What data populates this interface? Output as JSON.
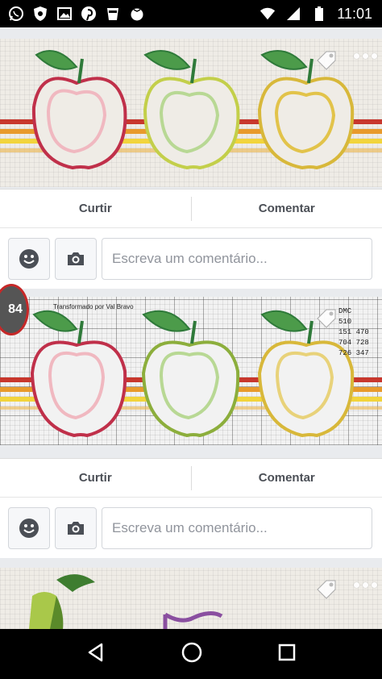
{
  "status_bar": {
    "time": "11:01",
    "left_icons": [
      "whatsapp-icon",
      "shield-icon",
      "image-icon",
      "pinterest-icon",
      "cup-icon",
      "tomato-icon"
    ],
    "right_icons": [
      "wifi-icon",
      "signal-icon",
      "battery-icon"
    ]
  },
  "posts": [
    {
      "image": "apple-cross-stitch",
      "like_label": "Curtir",
      "comment_label": "Comentar",
      "comment_placeholder": "Escreva um comentário..."
    },
    {
      "image": "apple-cross-stitch-chart",
      "credit": "Transformado por Val Bravo",
      "legend_title": "DMC",
      "legend_codes": [
        "510",
        "151",
        "704",
        "726",
        "470",
        "728",
        "347"
      ],
      "like_label": "Curtir",
      "comment_label": "Comentar",
      "comment_placeholder": "Escreva um comentário..."
    },
    {
      "image": "fruit-cross-stitch"
    }
  ],
  "badge": {
    "count": "84"
  },
  "colors": {
    "apple_red": "#c0304a",
    "apple_green": "#8cae3c",
    "apple_yellow": "#d8b83a",
    "leaf": "#4c9b4a",
    "stripe_red": "#c8372d",
    "stripe_orange": "#e89a2c",
    "stripe_yellow": "#f2d43c"
  },
  "nav_bar": {
    "icons": [
      "back-icon",
      "home-icon",
      "recents-icon"
    ]
  }
}
